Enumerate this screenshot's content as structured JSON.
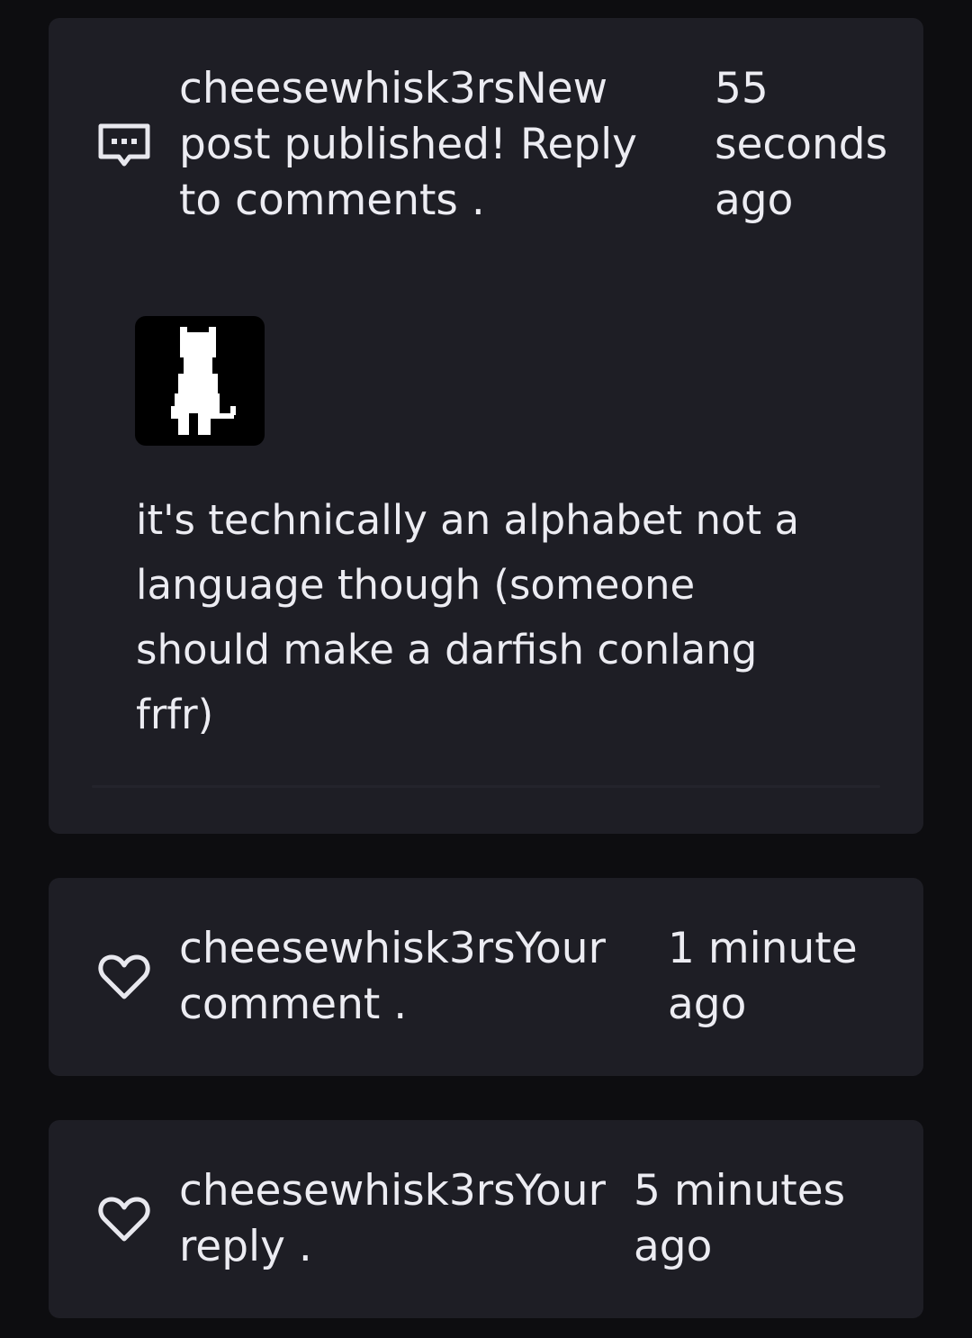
{
  "notifications": [
    {
      "icon": "comment-bubble-icon",
      "username": "cheesewhisk3rs",
      "message": "New post published! Reply to comments .",
      "time": "55 seconds ago",
      "preview": {
        "avatar": "pixel-cat-avatar",
        "text": "it's technically an alphabet not a language though (someone should make a darfish conlang frfr)"
      }
    },
    {
      "icon": "heart-outline-icon",
      "username": "cheesewhisk3rs",
      "message": "Your comment .",
      "time": "1 minute ago"
    },
    {
      "icon": "heart-outline-icon",
      "username": "cheesewhisk3rs",
      "message": "Your reply .",
      "time": "5 minutes ago"
    }
  ],
  "colors": {
    "background": "#0d0d10",
    "card": "#1e1e25",
    "text": "#ececf2"
  }
}
